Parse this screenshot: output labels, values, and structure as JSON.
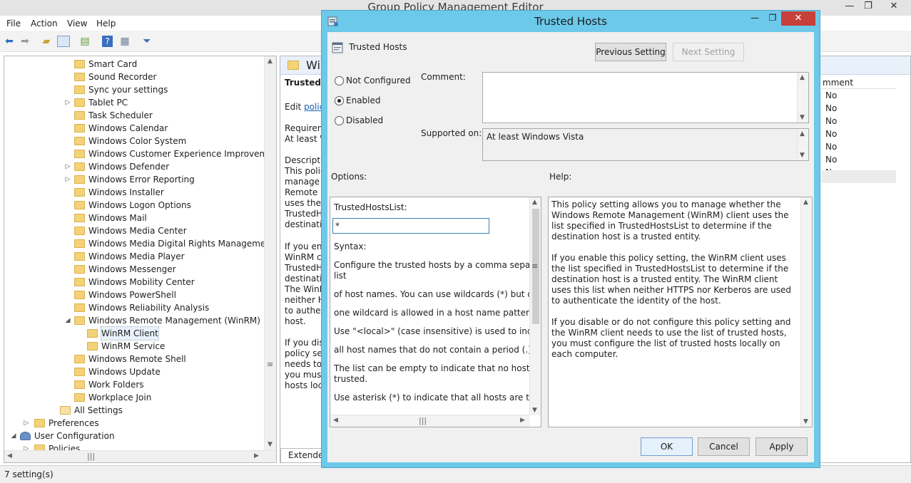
{
  "window": {
    "title": "Group Policy Management Editor",
    "minimize": "—",
    "maximize": "❐",
    "close": "✕"
  },
  "menu": [
    "File",
    "Action",
    "View",
    "Help"
  ],
  "tree": {
    "items": [
      {
        "label": "Smart Card",
        "expander": ""
      },
      {
        "label": "Sound Recorder",
        "expander": ""
      },
      {
        "label": "Sync your settings",
        "expander": ""
      },
      {
        "label": "Tablet PC",
        "expander": "▷"
      },
      {
        "label": "Task Scheduler",
        "expander": ""
      },
      {
        "label": "Windows Calendar",
        "expander": ""
      },
      {
        "label": "Windows Color System",
        "expander": ""
      },
      {
        "label": "Windows Customer Experience Improvement P",
        "expander": ""
      },
      {
        "label": "Windows Defender",
        "expander": "▷"
      },
      {
        "label": "Windows Error Reporting",
        "expander": "▷"
      },
      {
        "label": "Windows Installer",
        "expander": ""
      },
      {
        "label": "Windows Logon Options",
        "expander": ""
      },
      {
        "label": "Windows Mail",
        "expander": ""
      },
      {
        "label": "Windows Media Center",
        "expander": ""
      },
      {
        "label": "Windows Media Digital Rights Management",
        "expander": ""
      },
      {
        "label": "Windows Media Player",
        "expander": ""
      },
      {
        "label": "Windows Messenger",
        "expander": ""
      },
      {
        "label": "Windows Mobility Center",
        "expander": ""
      },
      {
        "label": "Windows PowerShell",
        "expander": ""
      },
      {
        "label": "Windows Reliability Analysis",
        "expander": ""
      },
      {
        "label": "Windows Remote Management (WinRM)",
        "expander": "◢"
      },
      {
        "label": "WinRM Client",
        "expander": ""
      },
      {
        "label": "WinRM Service",
        "expander": ""
      },
      {
        "label": "Windows Remote Shell",
        "expander": ""
      },
      {
        "label": "Windows Update",
        "expander": ""
      },
      {
        "label": "Work Folders",
        "expander": ""
      },
      {
        "label": "Workplace Join",
        "expander": ""
      },
      {
        "label": "All Settings",
        "expander": ""
      },
      {
        "label": "Preferences",
        "expander": "▷"
      },
      {
        "label": "User Configuration",
        "expander": "◢"
      },
      {
        "label": "Policies",
        "expander": "▷"
      }
    ]
  },
  "right_pane": {
    "header": "Win",
    "title": "Trusted H",
    "edit_prefix": "Edit ",
    "edit_link": "policy",
    "req_1": "Requirem",
    "req_2": "At least W",
    "desc_lines": [
      "Descriptio",
      "This policy",
      "manage w",
      "Remote M",
      "uses the li",
      "TrustedHo",
      "destinatio"
    ],
    "enable_lines": [
      "If you ena",
      "WinRM cl",
      "TrustedHo",
      "destinatio",
      "The WinR",
      "neither HT",
      "to authent",
      "host."
    ],
    "disable_lines": [
      "If you disa",
      "policy set",
      "needs to u",
      "you must",
      "hosts loca"
    ],
    "column_header": "mment",
    "column_values": [
      "No",
      "No",
      "No",
      "No",
      "No",
      "No",
      "No"
    ],
    "tab": "Extended"
  },
  "status": "7 setting(s)",
  "dialog": {
    "title": "Trusted Hosts",
    "setting_name": "Trusted Hosts",
    "prev_button": "Previous Setting",
    "next_button": "Next Setting",
    "radio_not_configured": "Not Configured",
    "radio_enabled": "Enabled",
    "radio_disabled": "Disabled",
    "selected_state": "Enabled",
    "comment_label": "Comment:",
    "comment_value": "",
    "supported_label": "Supported on:",
    "supported_value": "At least Windows Vista",
    "options_label": "Options:",
    "help_label": "Help:",
    "options": {
      "field_label": "TrustedHostsList:",
      "field_value": "*",
      "syntax": "Syntax:",
      "lines": [
        "Configure the trusted hosts by a comma separated",
        "list",
        "of host names. You can use wildcards (*) but only",
        "one wildcard is allowed in a host name pattern.",
        "Use \"<local>\" (case insensitive) is used to indicate",
        "all host names that do not contain a period (.).",
        "The list can be empty to indicate that no host is",
        "trusted.",
        "Use asterisk (*)  to indicate that all hosts are trusted."
      ]
    },
    "help": {
      "p1": "This policy setting allows you to manage whether the Windows Remote Management (WinRM) client uses the list specified in TrustedHostsList to determine if the destination host is a trusted entity.",
      "p2": "If you enable this policy setting, the WinRM client uses the list specified in TrustedHostsList to determine if the destination host is a trusted entity. The WinRM client uses this list when neither HTTPS nor Kerberos are used to authenticate the identity of the host.",
      "p3": "If you disable or do not configure this policy setting and the WinRM client needs to use the list of trusted hosts, you must configure the list of trusted hosts locally on each computer."
    },
    "ok": "OK",
    "cancel": "Cancel",
    "apply": "Apply",
    "minimize": "—",
    "maximize": "❐",
    "close": "✕"
  }
}
